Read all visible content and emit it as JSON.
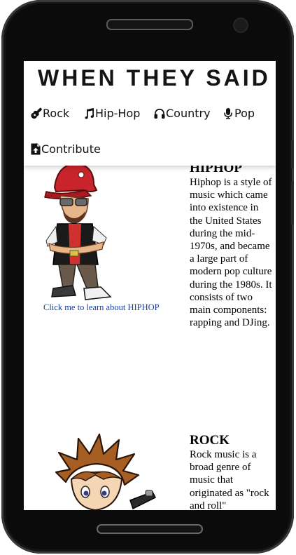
{
  "header": {
    "title": "WHEN THEY SAID",
    "nav": [
      {
        "label": "Rock",
        "icon": "guitar-icon"
      },
      {
        "label": "Hip-Hop",
        "icon": "music-note-icon"
      },
      {
        "label": "Country",
        "icon": "headphones-icon"
      },
      {
        "label": "Pop",
        "icon": "microphone-icon"
      },
      {
        "label": "Contribute",
        "icon": "file-upload-icon"
      }
    ]
  },
  "genres": [
    {
      "title": "HIPHOP",
      "description": "Hiphop is a style of music which came into existence in the United States during the mid-1970s, and became a large part of modern pop culture during the 1980s. It consists of two main components: rapping and DJing.",
      "link": "Click me to learn about HIPHOP",
      "image": "hiphop-character-illustration"
    },
    {
      "title": "ROCK",
      "description": "Rock music is a broad genre of music that originated as \"rock and roll\"",
      "image": "rock-character-illustration"
    }
  ],
  "colors": {
    "link": "#1a3fa0",
    "frame": "#0b0b0b",
    "cap_red": "#c8242c"
  }
}
